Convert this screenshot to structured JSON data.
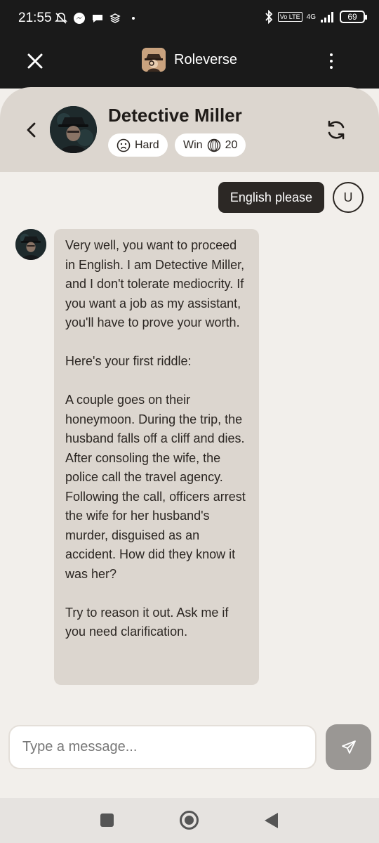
{
  "status_bar": {
    "time": "21:55",
    "battery": "69",
    "network": "4G"
  },
  "app_bar": {
    "title": "Roleverse"
  },
  "character": {
    "name": "Detective Miller",
    "difficulty": "Hard",
    "win_label": "Win",
    "win_amount": "20"
  },
  "messages": {
    "user": {
      "text": "English please",
      "avatar_letter": "U"
    },
    "bot": {
      "paragraphs": [
        "Very well, you want to proceed in English. I am Detective Miller, and I don't tolerate mediocrity. If you want a job as my assistant, you'll have to prove your worth.",
        "Here's your first riddle:",
        "A couple goes on their honeymoon. During the trip, the husband falls off a cliff and dies. After consoling the wife, the police call the travel agency. Following the call, officers arrest the wife for her husband's murder, disguised as an accident. How did they know it was her?",
        "Try to reason it out. Ask me if you need clarification."
      ]
    }
  },
  "composer": {
    "placeholder": "Type a message..."
  },
  "colors": {
    "header_bg": "#1a1a1a",
    "card_bg": "#dcd6cf",
    "page_bg": "#f2efeb",
    "user_bubble": "#2c2825",
    "send_button": "#9a9794"
  }
}
